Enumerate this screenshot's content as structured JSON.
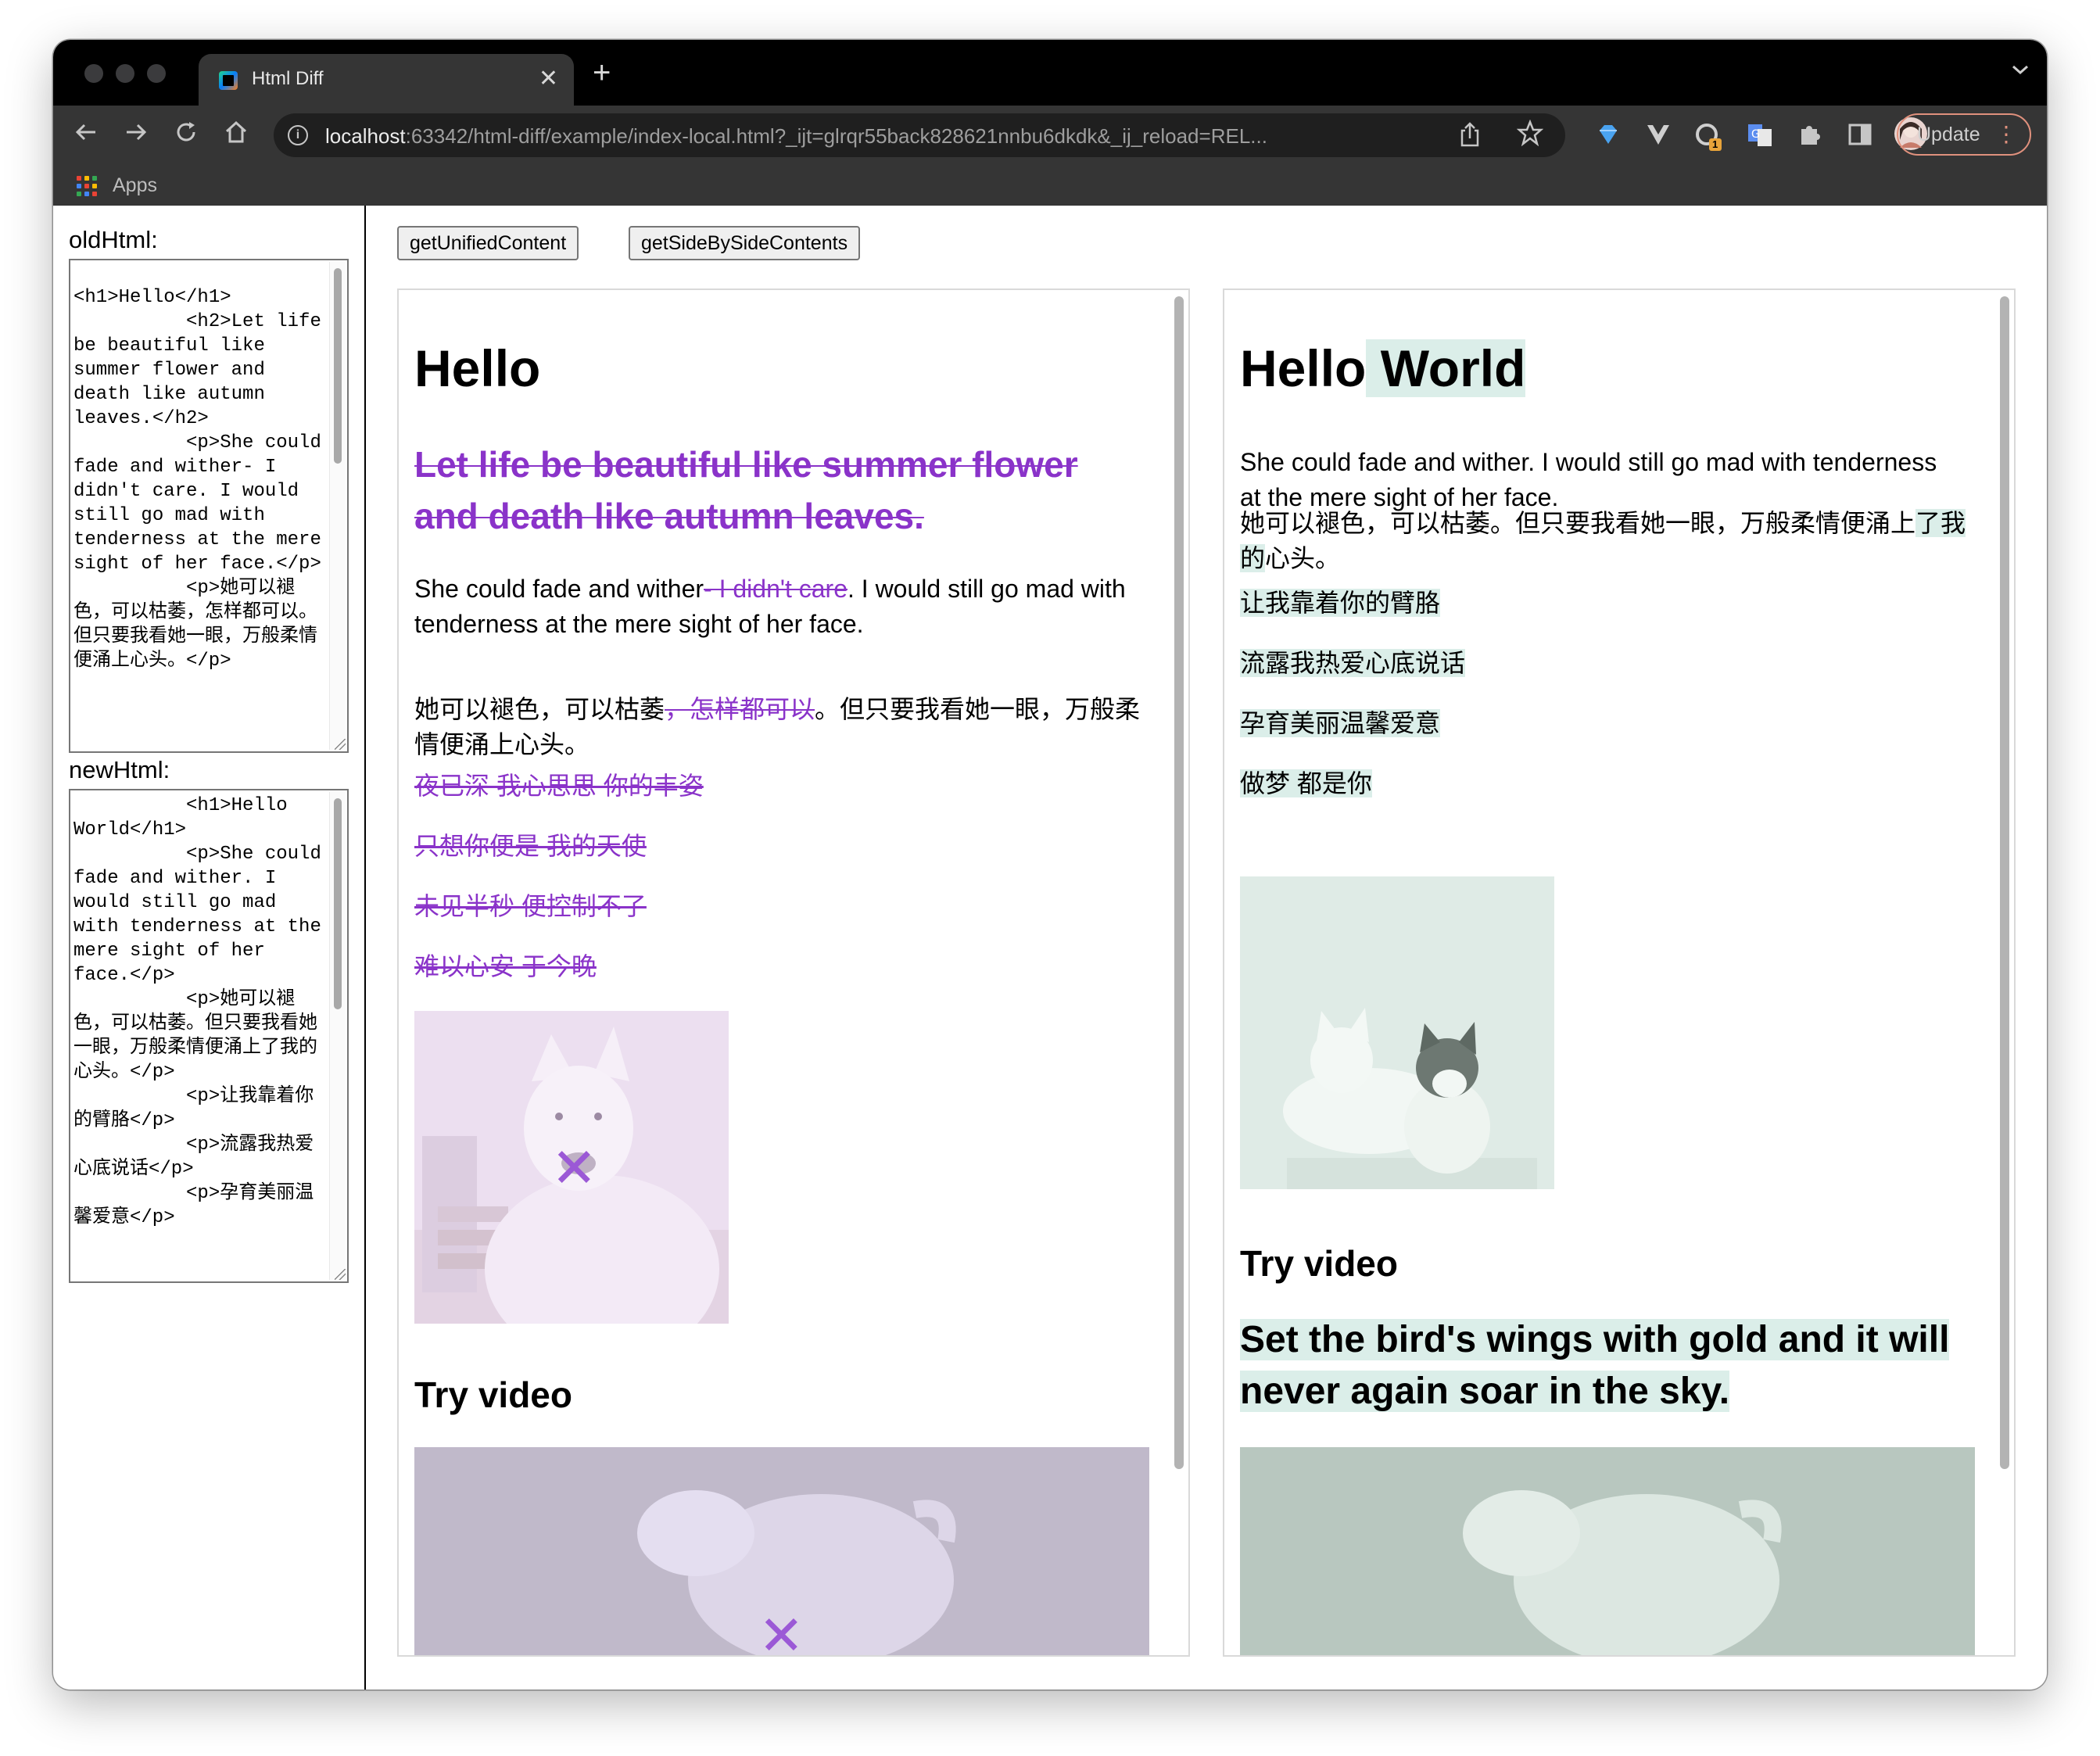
{
  "browser": {
    "tab_title": "Html Diff",
    "tab_close": "✕",
    "new_tab": "+",
    "url_host": "localhost",
    "url_rest": ":63342/html-diff/example/index-local.html?_ijt=glrqr55back828621nnbu6dkdk&_ij_reload=REL...",
    "update_label": "Update",
    "extension_badge": "1",
    "bookmark_apps": "Apps"
  },
  "colors": {
    "deleted_text": "#8a33c9",
    "inserted_bg": "#dbeee9"
  },
  "left_panel": {
    "old_label": "oldHtml:",
    "new_label": "newHtml:",
    "old_html": "<h1>Hello</h1>\n          <h2>Let life be beautiful like summer flower and death like autumn leaves.</h2>\n          <p>She could fade and wither- I didn't care. I would still go mad with tenderness at the mere sight of her face.</p>\n          <p>她可以褪色，可以枯萎，怎样都可以。但只要我看她一眼，万般柔情便涌上心头。</p>",
    "new_html": "          <h1>Hello World</h1>\n          <p>She could fade and wither. I would still go mad with tenderness at the mere sight of her face.</p>\n          <p>她可以褪色，可以枯萎。但只要我看她一眼，万般柔情便涌上了我的心头。</p>\n          <p>让我靠着你的臂胳</p>\n          <p>流露我热爱心底说话</p>\n          <p>孕育美丽温馨爱意</p>"
  },
  "buttons": {
    "unified": "getUnifiedContent",
    "side_by_side": "getSideBySideContents"
  },
  "old_pane": {
    "h1": "Hello",
    "h2_deleted": "Let life be beautiful like summer flower and death like autumn leaves.",
    "p1_a": "She could fade and wither",
    "p1_del": "- I didn't care",
    "p1_b": ". I would still go mad with tenderness at the mere sight of her face.",
    "p2_a": "她可以褪色，可以枯萎",
    "p2_del": "，怎样都可以",
    "p2_b": "。但只要我看她一眼，万般柔情便涌上心头。",
    "deleted_lines": [
      "夜已深 我心思思 你的丰姿",
      "只想你便是 我的天使",
      "未见半秒 便控制不了",
      "难以心安 于今晚"
    ],
    "h2_video": "Try video",
    "removed_mark": "✕"
  },
  "new_pane": {
    "h1_a": "Hello",
    "h1_ins": " World",
    "p1": "She could fade and wither. I would still go mad with tenderness at the mere sight of her face.",
    "p2_a": "她可以褪色，可以枯萎。但只要我看她一眼，万般柔情便涌上",
    "p2_ins": "了我的",
    "p2_b": "心头。",
    "inserted_lines": [
      "让我靠着你的臂胳",
      "流露我热爱心底说话",
      "孕育美丽温馨爱意",
      "做梦 都是你"
    ],
    "h2_video": "Try video",
    "h2_inserted": "Set the bird's wings with gold and it will never again soar in the sky."
  }
}
